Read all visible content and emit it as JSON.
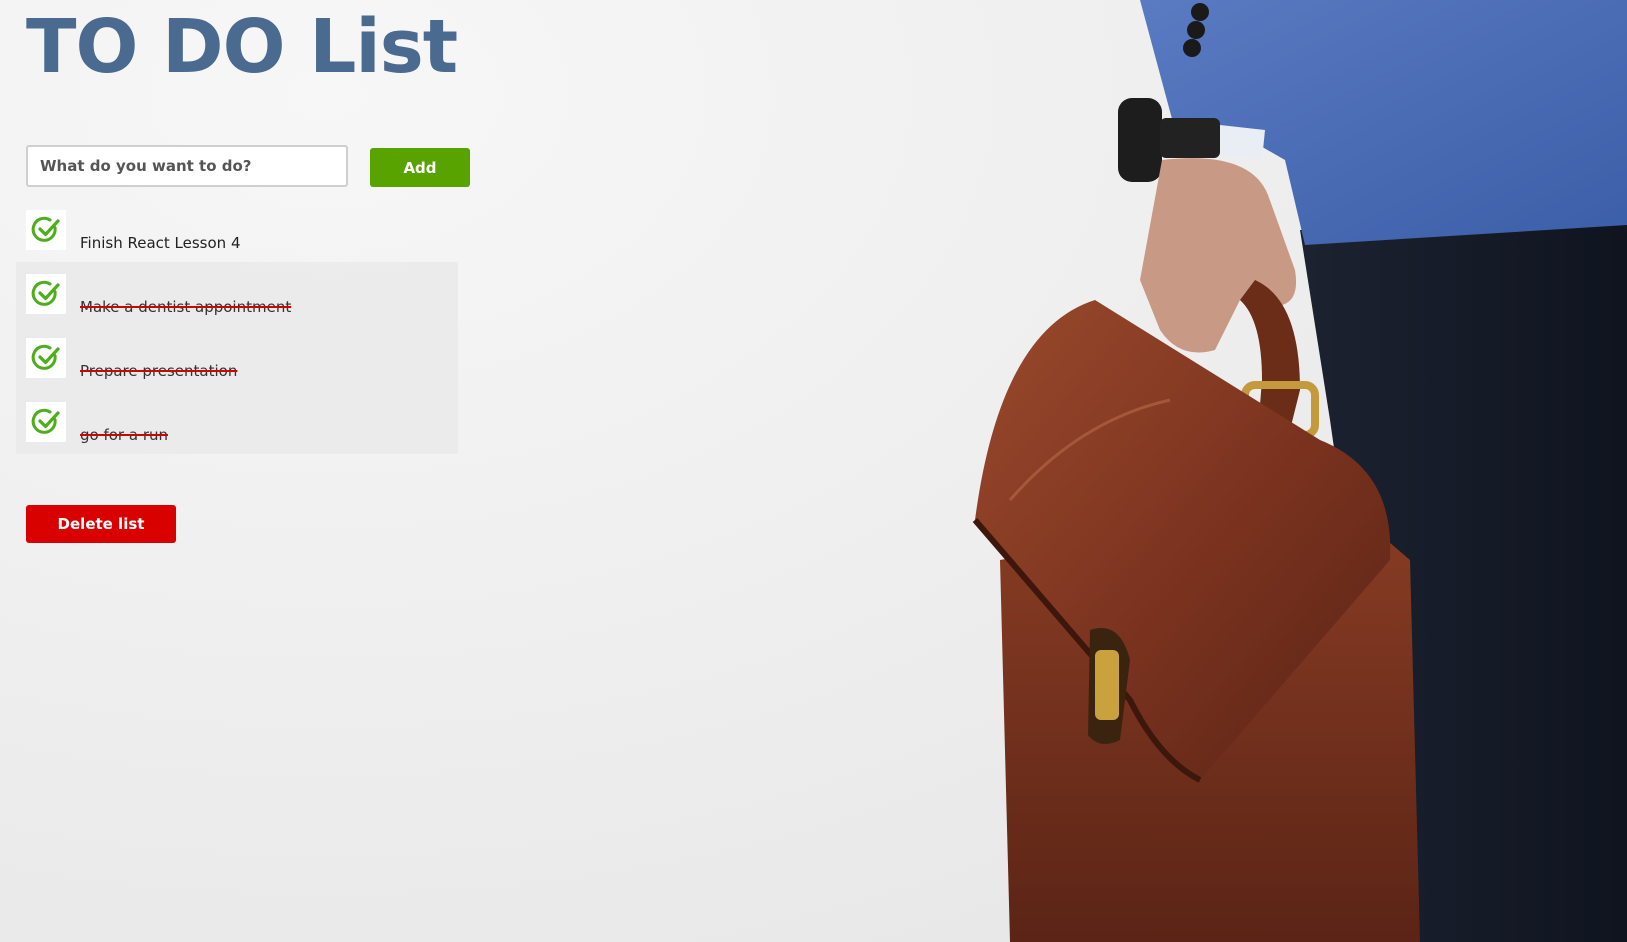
{
  "app": {
    "title": "TO DO List"
  },
  "form": {
    "input_placeholder": "What do you want to do?",
    "input_value": "",
    "add_label": "Add"
  },
  "todos": [
    {
      "label": "Finish React Lesson 4",
      "done": false
    },
    {
      "label": "Make a dentist appointment",
      "done": true
    },
    {
      "label": "Prepare presentation",
      "done": true
    },
    {
      "label": "go for a run",
      "done": true
    }
  ],
  "actions": {
    "delete_label": "Delete list"
  },
  "icons": {
    "check": "check-circle-icon"
  },
  "colors": {
    "title": "#4a6a8f",
    "add_button": "#58a300",
    "delete_button": "#d90000",
    "check": "#4caf1a",
    "strike": "#d40000"
  }
}
